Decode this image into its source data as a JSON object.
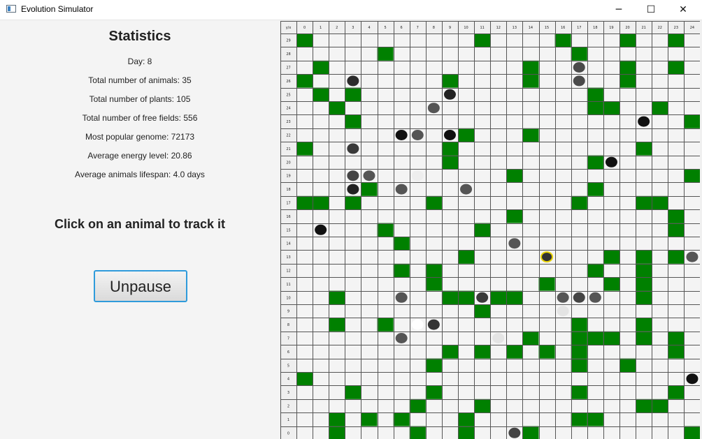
{
  "window": {
    "title": "Evolution Simulator",
    "minimize_glyph": "─",
    "maximize_glyph": "☐",
    "close_glyph": "✕"
  },
  "stats": {
    "title": "Statistics",
    "day": "Day: 8",
    "animals": "Total number of animals: 35",
    "plants": "Total number of plants: 105",
    "free_fields": "Total number of free fields: 556",
    "genome": "Most popular genome: 72173",
    "energy": "Average energy level: 20.86",
    "lifespan": "Average animals lifespan: 4.0 days"
  },
  "track_prompt": "Click on an animal to track it",
  "unpause_label": "Unpause",
  "map": {
    "corner_label": "y/x",
    "x_labels": [
      "0",
      "1",
      "2",
      "3",
      "4",
      "5",
      "6",
      "7",
      "8",
      "9",
      "10",
      "11",
      "12",
      "13",
      "14",
      "15",
      "16",
      "17",
      "18",
      "19",
      "20",
      "21",
      "22",
      "23",
      "24"
    ],
    "y_labels": [
      "29",
      "28",
      "27",
      "26",
      "25",
      "24",
      "23",
      "22",
      "21",
      "20",
      "19",
      "18",
      "17",
      "16",
      "15",
      "14",
      "13",
      "12",
      "11",
      "10",
      "9",
      "8",
      "7",
      "6",
      "5",
      "4",
      "3",
      "2",
      "1",
      "0"
    ],
    "plant_color": "#008000",
    "tracked_ring_color": "#e8d200",
    "plants": [
      [
        0,
        29
      ],
      [
        11,
        29
      ],
      [
        16,
        29
      ],
      [
        20,
        29
      ],
      [
        23,
        29
      ],
      [
        5,
        28
      ],
      [
        17,
        28
      ],
      [
        1,
        27
      ],
      [
        14,
        27
      ],
      [
        20,
        27
      ],
      [
        23,
        27
      ],
      [
        0,
        26
      ],
      [
        9,
        26
      ],
      [
        14,
        26
      ],
      [
        20,
        26
      ],
      [
        1,
        25
      ],
      [
        3,
        25
      ],
      [
        18,
        25
      ],
      [
        2,
        24
      ],
      [
        18,
        24
      ],
      [
        19,
        24
      ],
      [
        22,
        24
      ],
      [
        3,
        23
      ],
      [
        24,
        23
      ],
      [
        10,
        22
      ],
      [
        14,
        22
      ],
      [
        0,
        21
      ],
      [
        9,
        21
      ],
      [
        21,
        21
      ],
      [
        9,
        20
      ],
      [
        18,
        20
      ],
      [
        13,
        19
      ],
      [
        24,
        19
      ],
      [
        4,
        18
      ],
      [
        18,
        18
      ],
      [
        0,
        17
      ],
      [
        1,
        17
      ],
      [
        3,
        17
      ],
      [
        8,
        17
      ],
      [
        17,
        17
      ],
      [
        21,
        17
      ],
      [
        22,
        17
      ],
      [
        13,
        16
      ],
      [
        23,
        16
      ],
      [
        5,
        15
      ],
      [
        11,
        15
      ],
      [
        23,
        15
      ],
      [
        6,
        14
      ],
      [
        10,
        13
      ],
      [
        19,
        13
      ],
      [
        21,
        13
      ],
      [
        23,
        13
      ],
      [
        6,
        12
      ],
      [
        8,
        12
      ],
      [
        18,
        12
      ],
      [
        21,
        12
      ],
      [
        8,
        11
      ],
      [
        15,
        11
      ],
      [
        19,
        11
      ],
      [
        21,
        11
      ],
      [
        2,
        10
      ],
      [
        9,
        10
      ],
      [
        10,
        10
      ],
      [
        12,
        10
      ],
      [
        13,
        10
      ],
      [
        21,
        10
      ],
      [
        11,
        9
      ],
      [
        2,
        8
      ],
      [
        5,
        8
      ],
      [
        17,
        8
      ],
      [
        21,
        8
      ],
      [
        14,
        7
      ],
      [
        17,
        7
      ],
      [
        18,
        7
      ],
      [
        19,
        7
      ],
      [
        21,
        7
      ],
      [
        23,
        7
      ],
      [
        9,
        6
      ],
      [
        11,
        6
      ],
      [
        13,
        6
      ],
      [
        15,
        6
      ],
      [
        17,
        6
      ],
      [
        23,
        6
      ],
      [
        8,
        5
      ],
      [
        17,
        5
      ],
      [
        20,
        5
      ],
      [
        0,
        4
      ],
      [
        3,
        3
      ],
      [
        8,
        3
      ],
      [
        17,
        3
      ],
      [
        23,
        3
      ],
      [
        7,
        2
      ],
      [
        11,
        2
      ],
      [
        21,
        2
      ],
      [
        22,
        2
      ],
      [
        2,
        1
      ],
      [
        4,
        1
      ],
      [
        6,
        1
      ],
      [
        10,
        1
      ],
      [
        17,
        1
      ],
      [
        18,
        1
      ],
      [
        2,
        0
      ],
      [
        7,
        0
      ],
      [
        10,
        0
      ],
      [
        14,
        0
      ],
      [
        24,
        0
      ]
    ],
    "animals": [
      {
        "x": 17,
        "y": 27,
        "color": "#4a4a4a"
      },
      {
        "x": 3,
        "y": 26,
        "color": "#2c2c2c"
      },
      {
        "x": 17,
        "y": 26,
        "color": "#4a4a4a"
      },
      {
        "x": 9,
        "y": 25,
        "color": "#222222"
      },
      {
        "x": 8,
        "y": 24,
        "color": "#555555"
      },
      {
        "x": 21,
        "y": 23,
        "color": "#111111"
      },
      {
        "x": 6,
        "y": 22,
        "color": "#111111"
      },
      {
        "x": 7,
        "y": 22,
        "color": "#555555"
      },
      {
        "x": 9,
        "y": 22,
        "color": "#111111"
      },
      {
        "x": 3,
        "y": 21,
        "color": "#3a3a3a"
      },
      {
        "x": 19,
        "y": 20,
        "color": "#111111"
      },
      {
        "x": 3,
        "y": 19,
        "color": "#444444"
      },
      {
        "x": 4,
        "y": 19,
        "color": "#555555"
      },
      {
        "x": 7,
        "y": 19,
        "color": "#eeeeee"
      },
      {
        "x": 3,
        "y": 18,
        "color": "#222222"
      },
      {
        "x": 6,
        "y": 18,
        "color": "#555555"
      },
      {
        "x": 10,
        "y": 18,
        "color": "#555555"
      },
      {
        "x": 1,
        "y": 15,
        "color": "#111111"
      },
      {
        "x": 13,
        "y": 14,
        "color": "#555555"
      },
      {
        "x": 15,
        "y": 13,
        "color": "#333333",
        "tracked": true
      },
      {
        "x": 24,
        "y": 13,
        "color": "#555555"
      },
      {
        "x": 6,
        "y": 10,
        "color": "#555555"
      },
      {
        "x": 11,
        "y": 10,
        "color": "#3a3a3a"
      },
      {
        "x": 16,
        "y": 10,
        "color": "#555555"
      },
      {
        "x": 17,
        "y": 10,
        "color": "#444444"
      },
      {
        "x": 18,
        "y": 10,
        "color": "#555555"
      },
      {
        "x": 16,
        "y": 9,
        "color": "#e4e4e4"
      },
      {
        "x": 7,
        "y": 8,
        "color": "#ffffff"
      },
      {
        "x": 8,
        "y": 8,
        "color": "#333333"
      },
      {
        "x": 6,
        "y": 7,
        "color": "#555555"
      },
      {
        "x": 12,
        "y": 7,
        "color": "#e4e4e4"
      },
      {
        "x": 24,
        "y": 4,
        "color": "#111111"
      },
      {
        "x": 13,
        "y": 0,
        "color": "#444444"
      }
    ]
  }
}
